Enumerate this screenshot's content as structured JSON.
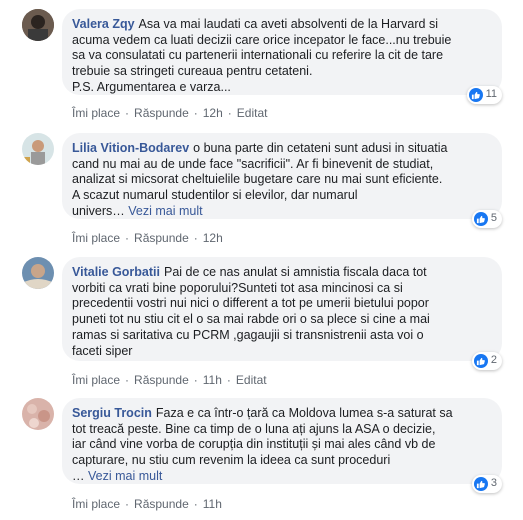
{
  "colors": {
    "link": "#385898",
    "bubble": "#f2f3f5",
    "meta": "#606770",
    "like": "#1877f2"
  },
  "comments": [
    {
      "author": "Valera Zqy",
      "lines": [
        "Asa va mai laudati ca aveti absolventi de la Harvard si",
        "acuma vedem ca luati decizii care orice incepator le face...nu trebuie",
        "sa va consulatati cu partenerii internationali cu referire la cit de tare",
        "trebuie sa stringeti cureaua pentru cetateni.",
        "P.S. Argumentarea e varza..."
      ],
      "reactions": "11",
      "like": "Îmi place",
      "reply": "Răspunde",
      "time": "12h",
      "edited": "Editat"
    },
    {
      "author": "Lilia Vition-Bodarev",
      "lines": [
        "o buna parte din cetateni sunt adusi in situatia",
        "cand nu mai au de unde face \"sacrificii\". Ar fi binevenit de studiat,",
        "analizat si micsorat cheltuielile bugetare care nu mai sunt eficiente.",
        "A scazut numarul studentilor si elevilor, dar numarul",
        "univers…"
      ],
      "see_more": "Vezi mai mult",
      "reactions": "5",
      "like": "Îmi place",
      "reply": "Răspunde",
      "time": "12h"
    },
    {
      "author": "Vitalie Gorbatii",
      "lines": [
        "Pai de ce nas anulat si amnistia fiscala daca tot",
        "vorbiti ca vrati bine poporului?Sunteti tot asa mincinosi ca si",
        "precedentii vostri nui nici o different a tot pe umerii bietului popor",
        "puneti tot nu stiu cit el o sa mai rabde ori o sa plece si cine a mai",
        "ramas si saritativa cu PCRM ,gagaujii si transnistrenii asta voi o",
        "faceti siper"
      ],
      "reactions": "2",
      "like": "Îmi place",
      "reply": "Răspunde",
      "time": "11h",
      "edited": "Editat"
    },
    {
      "author": "Sergiu Trocin",
      "lines": [
        "Faza e ca într-o țară ca Moldova lumea s-a saturat sa",
        "tot treacă peste. Bine ca timp de o luna ați ajuns la ASA o decizie,",
        "iar când vine vorba de corupția din instituții și mai ales când vb de",
        "capturare, nu stiu cum revenim la ideea ca sunt proceduri",
        "…"
      ],
      "see_more": "Vezi mai mult",
      "reactions": "3",
      "like": "Îmi place",
      "reply": "Răspunde",
      "time": "11h"
    }
  ]
}
